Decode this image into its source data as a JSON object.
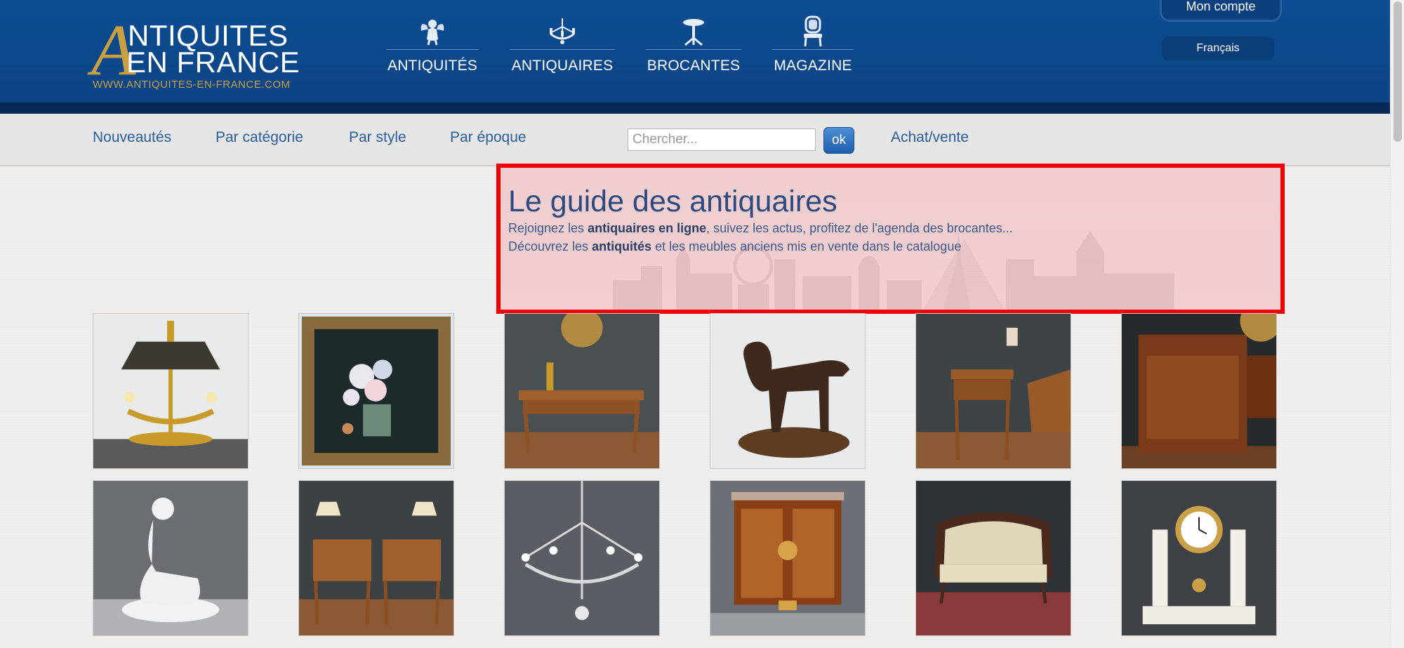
{
  "logo": {
    "initial": "A",
    "line1": "NTIQUITES",
    "line2": "EN FRANCE",
    "url": "WWW.ANTIQUITES-EN-FRANCE.COM"
  },
  "mainnav": [
    {
      "label": "ANTIQUITÉS",
      "icon": "cherub-icon"
    },
    {
      "label": "ANTIQUAIRES",
      "icon": "chandelier-icon"
    },
    {
      "label": "BROCANTES",
      "icon": "gueridon-table-icon"
    },
    {
      "label": "MAGAZINE",
      "icon": "chair-icon"
    }
  ],
  "account": {
    "label": "Mon compte"
  },
  "language": {
    "label": "Français"
  },
  "subnav": {
    "items": [
      "Nouveautés",
      "Par catégorie",
      "Par style",
      "Par époque"
    ],
    "search_placeholder": "Chercher...",
    "search_button": "ok",
    "achat_vente": "Achat/vente"
  },
  "hero": {
    "title": "Le guide des antiquaires",
    "line1_pre": "Rejoignez les ",
    "line1_bold": "antiquaires en ligne",
    "line1_post": ", suivez les actus, profitez de l'agenda des brocantes...",
    "line2_pre": "Découvrez les ",
    "line2_bold": "antiquités",
    "line2_post": " et les meubles anciens mis en vente dans le catalogue"
  },
  "products": [
    {
      "name": "bouillotte-lamp-image"
    },
    {
      "name": "flower-painting-image"
    },
    {
      "name": "writing-desk-image"
    },
    {
      "name": "bronze-dog-image"
    },
    {
      "name": "side-table-image"
    },
    {
      "name": "cabinet-image"
    },
    {
      "name": "porcelain-figure-image"
    },
    {
      "name": "bedside-tables-image"
    },
    {
      "name": "crystal-chandelier-image"
    },
    {
      "name": "marquetry-commode-image"
    },
    {
      "name": "settee-image"
    },
    {
      "name": "mantel-clock-image"
    }
  ],
  "colors": {
    "header_blue": "#0c4789",
    "gold": "#c8a043",
    "link_blue": "#2c5e99",
    "highlight_red": "#f00000"
  }
}
